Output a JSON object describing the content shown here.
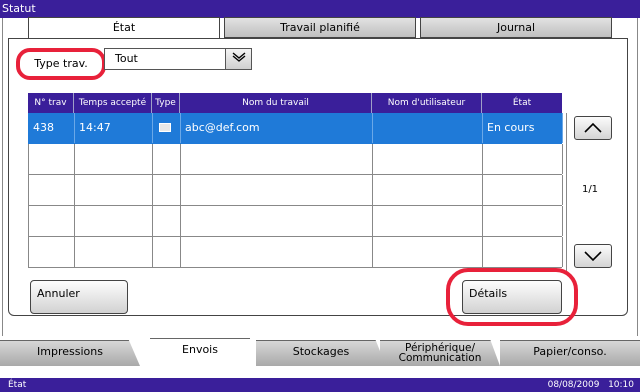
{
  "window": {
    "title": "Statut"
  },
  "tabs": [
    {
      "label": "État",
      "active": true
    },
    {
      "label": "Travail planifié",
      "active": false
    },
    {
      "label": "Journal",
      "active": false
    }
  ],
  "filter": {
    "label": "Type trav.",
    "value": "Tout"
  },
  "table": {
    "columns": [
      "N° trav",
      "Temps accepté",
      "Type",
      "Nom du travail",
      "Nom d'utilisateur",
      "État"
    ],
    "rows": [
      {
        "job_no": "438",
        "time": "14:47",
        "type_icon": "mail-icon",
        "job_name": "abc@def.com",
        "user": "",
        "state": "En cours",
        "selected": true
      }
    ],
    "empty_rows": 4
  },
  "pagination": {
    "label": "1/1"
  },
  "buttons": {
    "cancel": "Annuler",
    "details": "Détails"
  },
  "bottom_tabs": [
    {
      "label": "Impressions",
      "active": false
    },
    {
      "label": "Envois",
      "active": true
    },
    {
      "label": "Stockages",
      "active": false
    },
    {
      "label": "Périphérique/ Communication",
      "active": false
    },
    {
      "label": "Papier/conso.",
      "active": false
    }
  ],
  "status": {
    "left": "État",
    "date": "08/08/2009",
    "time": "10:10"
  },
  "colors": {
    "title_bar": "#3a1f9a",
    "selected_row": "#1f7ad8",
    "highlight_ring": "#e8213a"
  }
}
